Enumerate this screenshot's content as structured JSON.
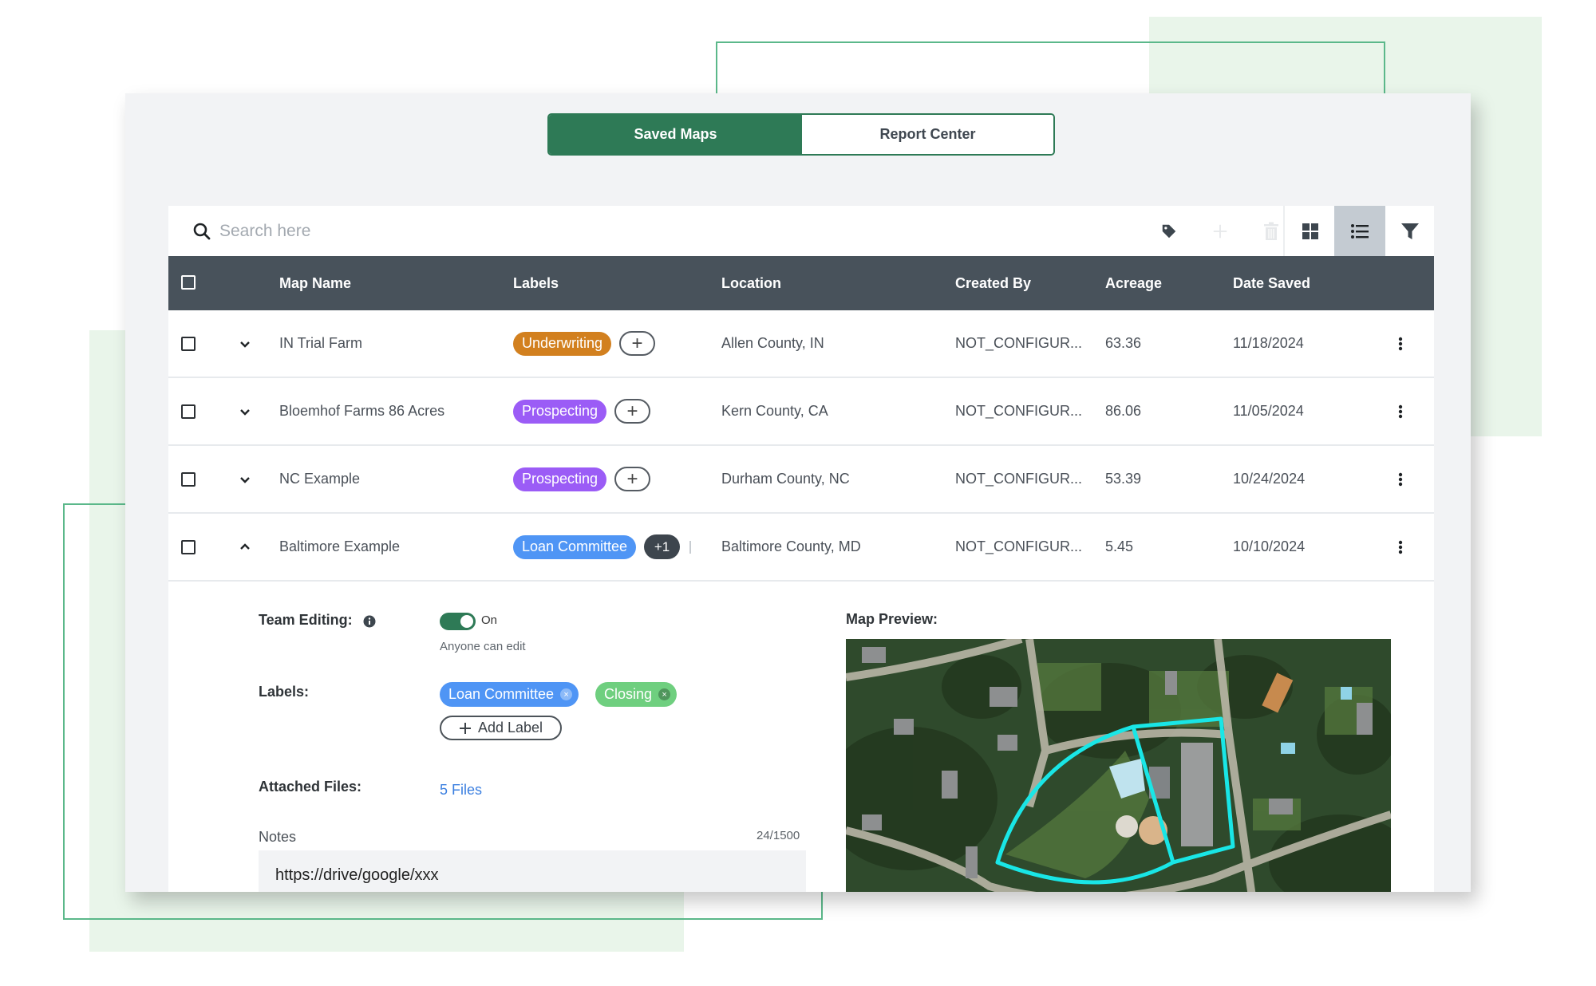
{
  "tabs": {
    "saved_maps": "Saved Maps",
    "report_center": "Report Center",
    "active": "saved_maps"
  },
  "search": {
    "placeholder": "Search here",
    "value": ""
  },
  "toolbar": {
    "icons": [
      "tag-icon",
      "plus-icon",
      "trash-icon",
      "grid-view-icon",
      "list-view-icon",
      "filter-icon"
    ],
    "active_view": "list"
  },
  "table": {
    "columns": [
      "Map Name",
      "Labels",
      "Location",
      "Created By",
      "Acreage",
      "Date Saved"
    ],
    "rows": [
      {
        "name": "IN Trial Farm",
        "labels": [
          {
            "text": "Underwriting",
            "color": "#d2801f"
          }
        ],
        "extra_labels": "",
        "location": "Allen County, IN",
        "created_by": "NOT_CONFIGUR...",
        "acreage": "63.36",
        "date_saved": "11/18/2024",
        "expanded": false
      },
      {
        "name": "Bloemhof Farms 86 Acres",
        "labels": [
          {
            "text": "Prospecting",
            "color": "#9b5cf6"
          }
        ],
        "extra_labels": "",
        "location": "Kern County, CA",
        "created_by": "NOT_CONFIGUR...",
        "acreage": "86.06",
        "date_saved": "11/05/2024",
        "expanded": false
      },
      {
        "name": "NC Example",
        "labels": [
          {
            "text": "Prospecting",
            "color": "#9b5cf6"
          }
        ],
        "extra_labels": "",
        "location": "Durham County, NC",
        "created_by": "NOT_CONFIGUR...",
        "acreage": "53.39",
        "date_saved": "10/24/2024",
        "expanded": false
      },
      {
        "name": "Baltimore Example",
        "labels": [
          {
            "text": "Loan Committee",
            "color": "#4f95f5"
          }
        ],
        "extra_labels": "+1",
        "location": "Baltimore County, MD",
        "created_by": "NOT_CONFIGUR...",
        "acreage": "5.45",
        "date_saved": "10/10/2024",
        "expanded": true
      }
    ]
  },
  "details": {
    "team_editing_label": "Team Editing:",
    "team_editing_state": "On",
    "team_editing_enabled": true,
    "team_editing_hint": "Anyone can edit",
    "labels_label": "Labels:",
    "labels": [
      {
        "text": "Loan Committee",
        "color": "#4f95f5"
      },
      {
        "text": "Closing",
        "color": "#6fcf7f"
      }
    ],
    "add_label": "Add Label",
    "attached_files_label": "Attached Files:",
    "attached_files_link": "5 Files",
    "notes_label": "Notes",
    "notes_count": "24/1500",
    "notes_value": "https://drive/google/xxx",
    "map_preview_label": "Map Preview:"
  },
  "colors": {
    "brand_green": "#2e7a56",
    "header_dark": "#48525b",
    "parcel_outline": "#19e6e6"
  }
}
